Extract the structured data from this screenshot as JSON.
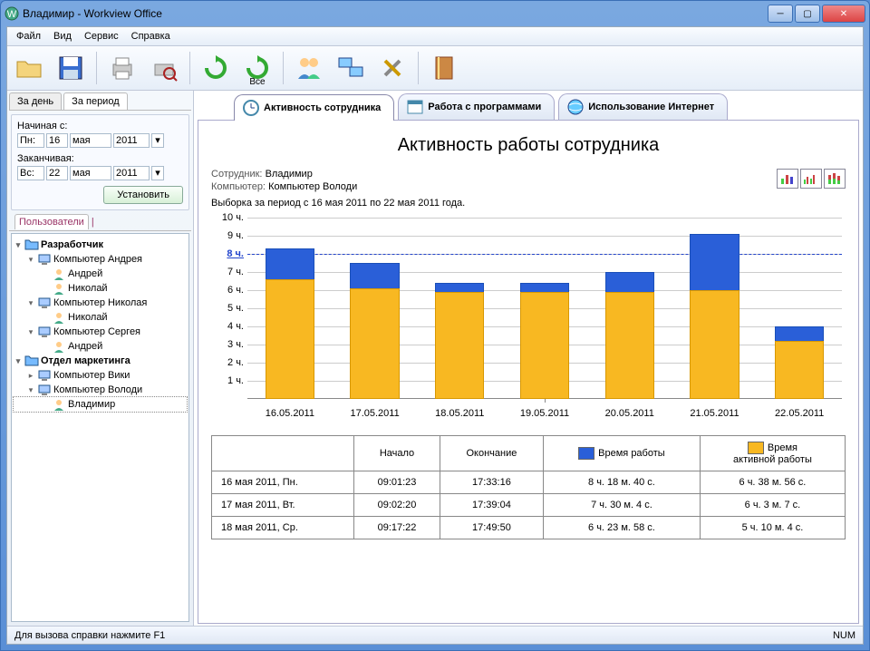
{
  "window": {
    "title": "Владимир - Workview Office"
  },
  "menu": {
    "file": "Файл",
    "view": "Вид",
    "service": "Сервис",
    "help": "Справка"
  },
  "toolbar": {
    "all_label": "Все"
  },
  "side_tabs": {
    "day": "За день",
    "period": "За период"
  },
  "date_panel": {
    "start_label": "Начиная с:",
    "end_label": "Заканчивая:",
    "start": {
      "dow": "Пн:",
      "day": "16",
      "month": "мая",
      "year": "2011"
    },
    "end": {
      "dow": "Вс:",
      "day": "22",
      "month": "мая",
      "year": "2011"
    },
    "set_btn": "Установить"
  },
  "users_header": "Пользователи",
  "tree": [
    {
      "lvl": 0,
      "label": "Разработчик",
      "bold": true,
      "icon": "folder",
      "exp": true
    },
    {
      "lvl": 1,
      "label": "Компьютер Андрея",
      "icon": "pc",
      "exp": true
    },
    {
      "lvl": 2,
      "label": "Андрей",
      "icon": "user"
    },
    {
      "lvl": 2,
      "label": "Николай",
      "icon": "user"
    },
    {
      "lvl": 1,
      "label": "Компьютер Николая",
      "icon": "pc",
      "exp": true
    },
    {
      "lvl": 2,
      "label": "Николай",
      "icon": "user"
    },
    {
      "lvl": 1,
      "label": "Компьютер Сергея",
      "icon": "pc",
      "exp": true
    },
    {
      "lvl": 2,
      "label": "Андрей",
      "icon": "user"
    },
    {
      "lvl": 0,
      "label": "Отдел маркетинга",
      "bold": true,
      "icon": "folder",
      "exp": true
    },
    {
      "lvl": 1,
      "label": "Компьютер Вики",
      "icon": "pc",
      "exp": false
    },
    {
      "lvl": 1,
      "label": "Компьютер Володи",
      "icon": "pc",
      "exp": true
    },
    {
      "lvl": 2,
      "label": "Владимир",
      "icon": "user",
      "sel": true
    }
  ],
  "main_tabs": {
    "activity": "Активность сотрудника",
    "programs": "Работа с программами",
    "internet": "Использование Интернет"
  },
  "report": {
    "title": "Активность работы сотрудника",
    "employee_lbl": "Сотрудник:",
    "employee": "Владимир",
    "computer_lbl": "Компьютер:",
    "computer": "Компьютер Володи",
    "period_line": "Выборка за период с 16 мая 2011 по 22 мая 2011 года."
  },
  "chart_data": {
    "type": "bar",
    "title": "Активность работы сотрудника",
    "xlabel": "",
    "ylabel": "",
    "ylim": [
      0,
      10
    ],
    "y_ticks": [
      "1 ч.",
      "2 ч.",
      "3 ч.",
      "4 ч.",
      "5 ч.",
      "6 ч.",
      "7 ч.",
      "8 ч.",
      "9 ч.",
      "10 ч."
    ],
    "reference": 8,
    "categories": [
      "16.05.2011",
      "17.05.2011",
      "18.05.2011",
      "19.05.2011",
      "20.05.2011",
      "21.05.2011",
      "22.05.2011"
    ],
    "series": [
      {
        "name": "Время работы",
        "color": "#2a5fd8",
        "values": [
          8.3,
          7.5,
          6.4,
          6.4,
          7.0,
          9.1,
          4.0
        ]
      },
      {
        "name": "Время активной работы",
        "color": "#f8b822",
        "values": [
          6.6,
          6.1,
          5.9,
          5.9,
          5.9,
          6.0,
          3.2
        ]
      }
    ]
  },
  "table": {
    "headers": {
      "start": "Начало",
      "end": "Окончание",
      "work": "Время работы",
      "active": "Время\nактивной работы"
    },
    "rows": [
      {
        "date": "16 мая 2011, Пн.",
        "start": "09:01:23",
        "end": "17:33:16",
        "work": "8 ч. 18 м. 40 с.",
        "active": "6 ч. 38 м. 56 с."
      },
      {
        "date": "17 мая 2011, Вт.",
        "start": "09:02:20",
        "end": "17:39:04",
        "work": "7 ч. 30 м. 4 с.",
        "active": "6 ч. 3 м. 7 с."
      },
      {
        "date": "18 мая 2011, Ср.",
        "start": "09:17:22",
        "end": "17:49:50",
        "work": "6 ч. 23 м. 58 с.",
        "active": "5 ч. 10 м. 4 с."
      }
    ]
  },
  "statusbar": {
    "hint": "Для вызова справки нажмите F1",
    "num": "NUM"
  }
}
